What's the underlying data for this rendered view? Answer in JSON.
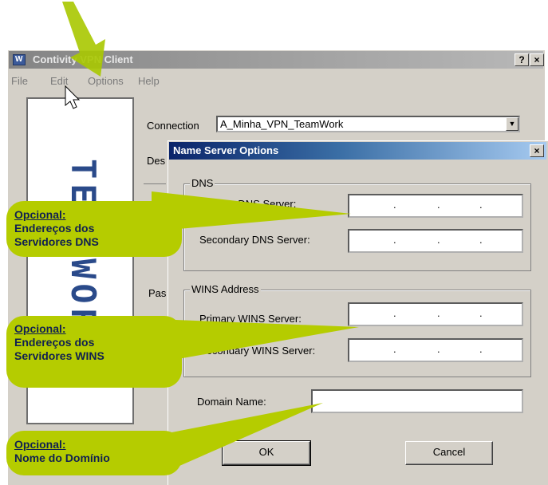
{
  "window": {
    "title": "Contivity VPN Client",
    "icon_text": "W",
    "help_btn": "?",
    "close_btn": "×"
  },
  "menu": {
    "items": [
      "File",
      "Edit",
      "Options",
      "Help"
    ]
  },
  "logo_text": "TEAMWORK",
  "main": {
    "connection_label": "Connection",
    "connection_value": "A_Minha_VPN_TeamWork",
    "des_label": "Des",
    "pas_label": "Pas"
  },
  "dialog": {
    "title": "Name Server Options",
    "close_btn": "×",
    "dns_group": "DNS",
    "primary_dns_label": "Primary DNS Server:",
    "secondary_dns_label": "Secondary DNS Server:",
    "wins_group": "WINS Address",
    "primary_wins_label": "Primary WINS Server:",
    "secondary_wins_label": "Secondary WINS Server:",
    "domain_label": "Domain Name:",
    "domain_value": "",
    "ip_dot": ".",
    "ok_label": "OK",
    "cancel_label": "Cancel"
  },
  "annotations": [
    {
      "head": "Opcional:",
      "body": "Endereços dos\nServidores DNS"
    },
    {
      "head": "Opcional:",
      "body": "Endereços dos\nServidores WINS"
    },
    {
      "head": "Opcional:",
      "body": "Nome do Domínio"
    }
  ],
  "colors": {
    "callout": "#b5cc00",
    "callout_text": "#102050",
    "dialog_title": "#0a246a"
  }
}
